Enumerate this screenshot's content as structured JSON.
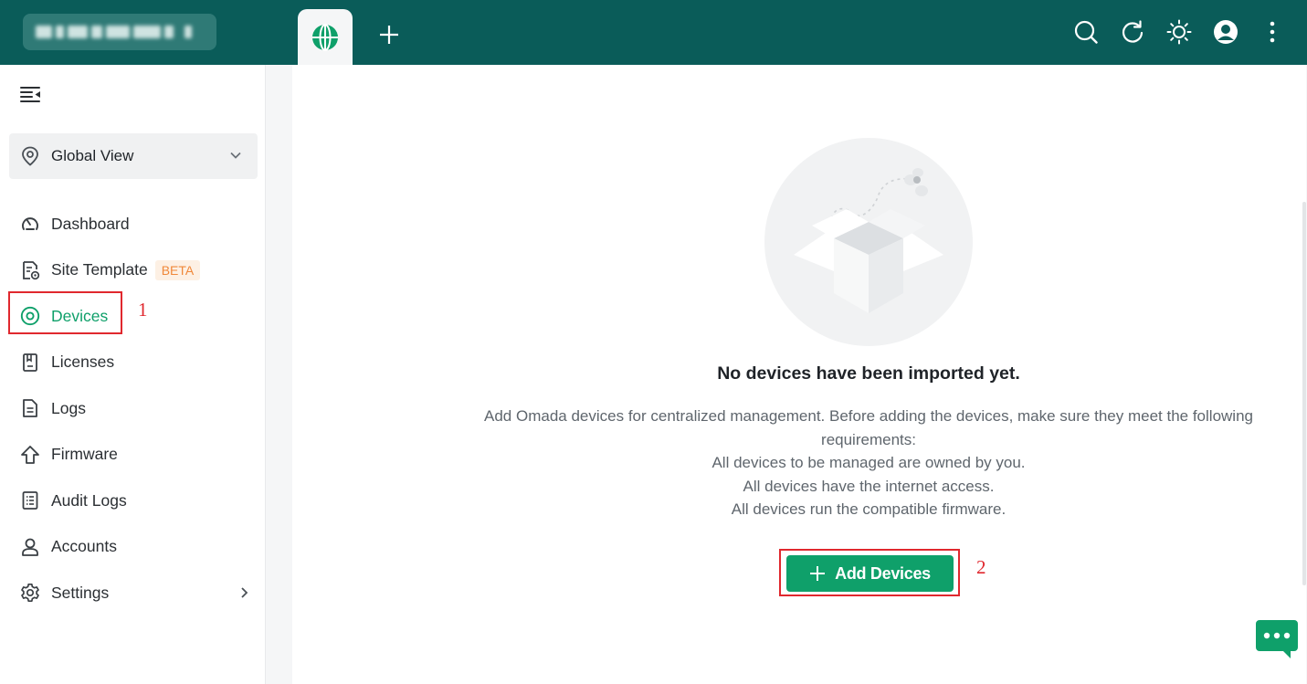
{
  "topbar": {
    "active_tab_icon": "globe-icon",
    "add_tab_icon": "plus-icon",
    "icons": [
      "search-icon",
      "refresh-icon",
      "sun-icon",
      "avatar",
      "more-vertical-icon"
    ]
  },
  "sidebar": {
    "site_selector": {
      "label": "Global View"
    },
    "items": [
      {
        "label": "Dashboard",
        "icon": "dashboard-icon"
      },
      {
        "label": "Site Template",
        "icon": "site-template-icon",
        "badge": "BETA"
      },
      {
        "label": "Devices",
        "icon": "devices-icon",
        "active": true
      },
      {
        "label": "Licenses",
        "icon": "licenses-icon"
      },
      {
        "label": "Logs",
        "icon": "logs-icon"
      },
      {
        "label": "Firmware",
        "icon": "firmware-icon"
      },
      {
        "label": "Audit Logs",
        "icon": "audit-logs-icon"
      },
      {
        "label": "Accounts",
        "icon": "accounts-icon"
      },
      {
        "label": "Settings",
        "icon": "settings-icon",
        "has_submenu": true
      }
    ]
  },
  "main": {
    "empty_title": "No devices have been imported yet.",
    "empty_desc_lines": [
      "Add Omada devices for centralized management. Before adding the devices, make sure they meet the following requirements:",
      "All devices to be managed are owned by you.",
      "All devices have the internet access.",
      "All devices run the compatible firmware."
    ],
    "add_button_label": "Add Devices"
  },
  "annotations": {
    "step1": "1",
    "step2": "2"
  },
  "colors": {
    "topbar": "#0a5c59",
    "accent": "#0fa06a",
    "callout": "#e0282e",
    "beta_text": "#f0883a",
    "beta_bg": "#fdf0e4"
  }
}
